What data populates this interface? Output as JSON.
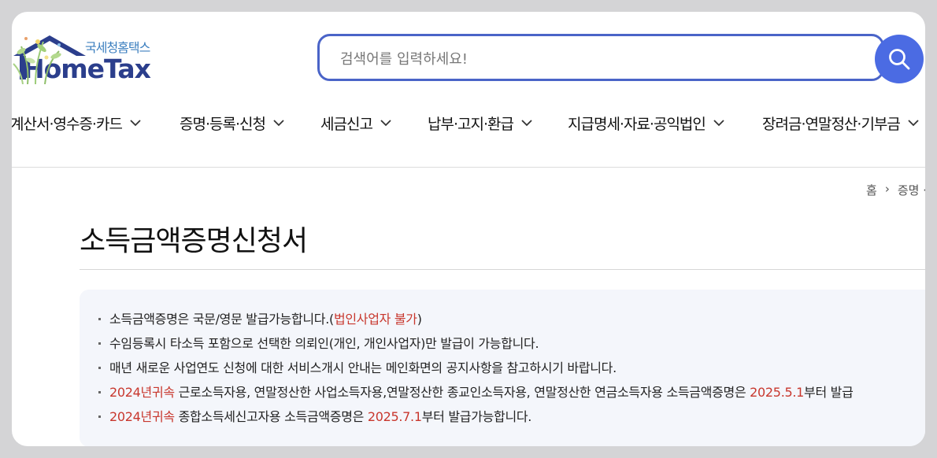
{
  "logo": {
    "sub_label": "국세청홈택스",
    "main_label": "HomeTax"
  },
  "search": {
    "placeholder": "검색어를 입력하세요!"
  },
  "nav": {
    "items": [
      {
        "label": "계산서·영수증·카드"
      },
      {
        "label": "증명·등록·신청"
      },
      {
        "label": "세금신고"
      },
      {
        "label": "납부·고지·환급"
      },
      {
        "label": "지급명세·자료·공익법인"
      },
      {
        "label": "장려금·연말정산·기부금"
      }
    ]
  },
  "breadcrumb": {
    "home": "홈",
    "sep": "›",
    "current": "증명 ·"
  },
  "page": {
    "title": "소득금액증명신청서"
  },
  "notice": {
    "items": [
      {
        "parts": [
          "소득금액증명은 국문/영문 발급가능합니다.(",
          "법인사업자 불가",
          ")"
        ]
      },
      {
        "parts": [
          "수임등록시 타소득 포함으로 선택한 의뢰인(개인, 개인사업자)만 발급이 가능합니다."
        ]
      },
      {
        "parts": [
          "매년 새로운 사업연도 신청에 대한 서비스개시 안내는 메인화면의 공지사항을 참고하시기 바랍니다."
        ]
      },
      {
        "parts": [
          "2024년귀속",
          " 근로소득자용, 연말정산한 사업소득자용,연말정산한 종교인소득자용, 연말정산한 연금소득자용 소득금액증명은 ",
          "2025.5.1",
          "부터 발급"
        ]
      },
      {
        "parts": [
          "2024년귀속",
          " 종합소득세신고자용 소득금액증명은 ",
          "2025.7.1",
          "부터 발급가능합니다."
        ]
      }
    ]
  },
  "colors": {
    "accent": "#4b6be3",
    "emphasis": "#c8372d",
    "brand_dark": "#2b3e8c"
  }
}
